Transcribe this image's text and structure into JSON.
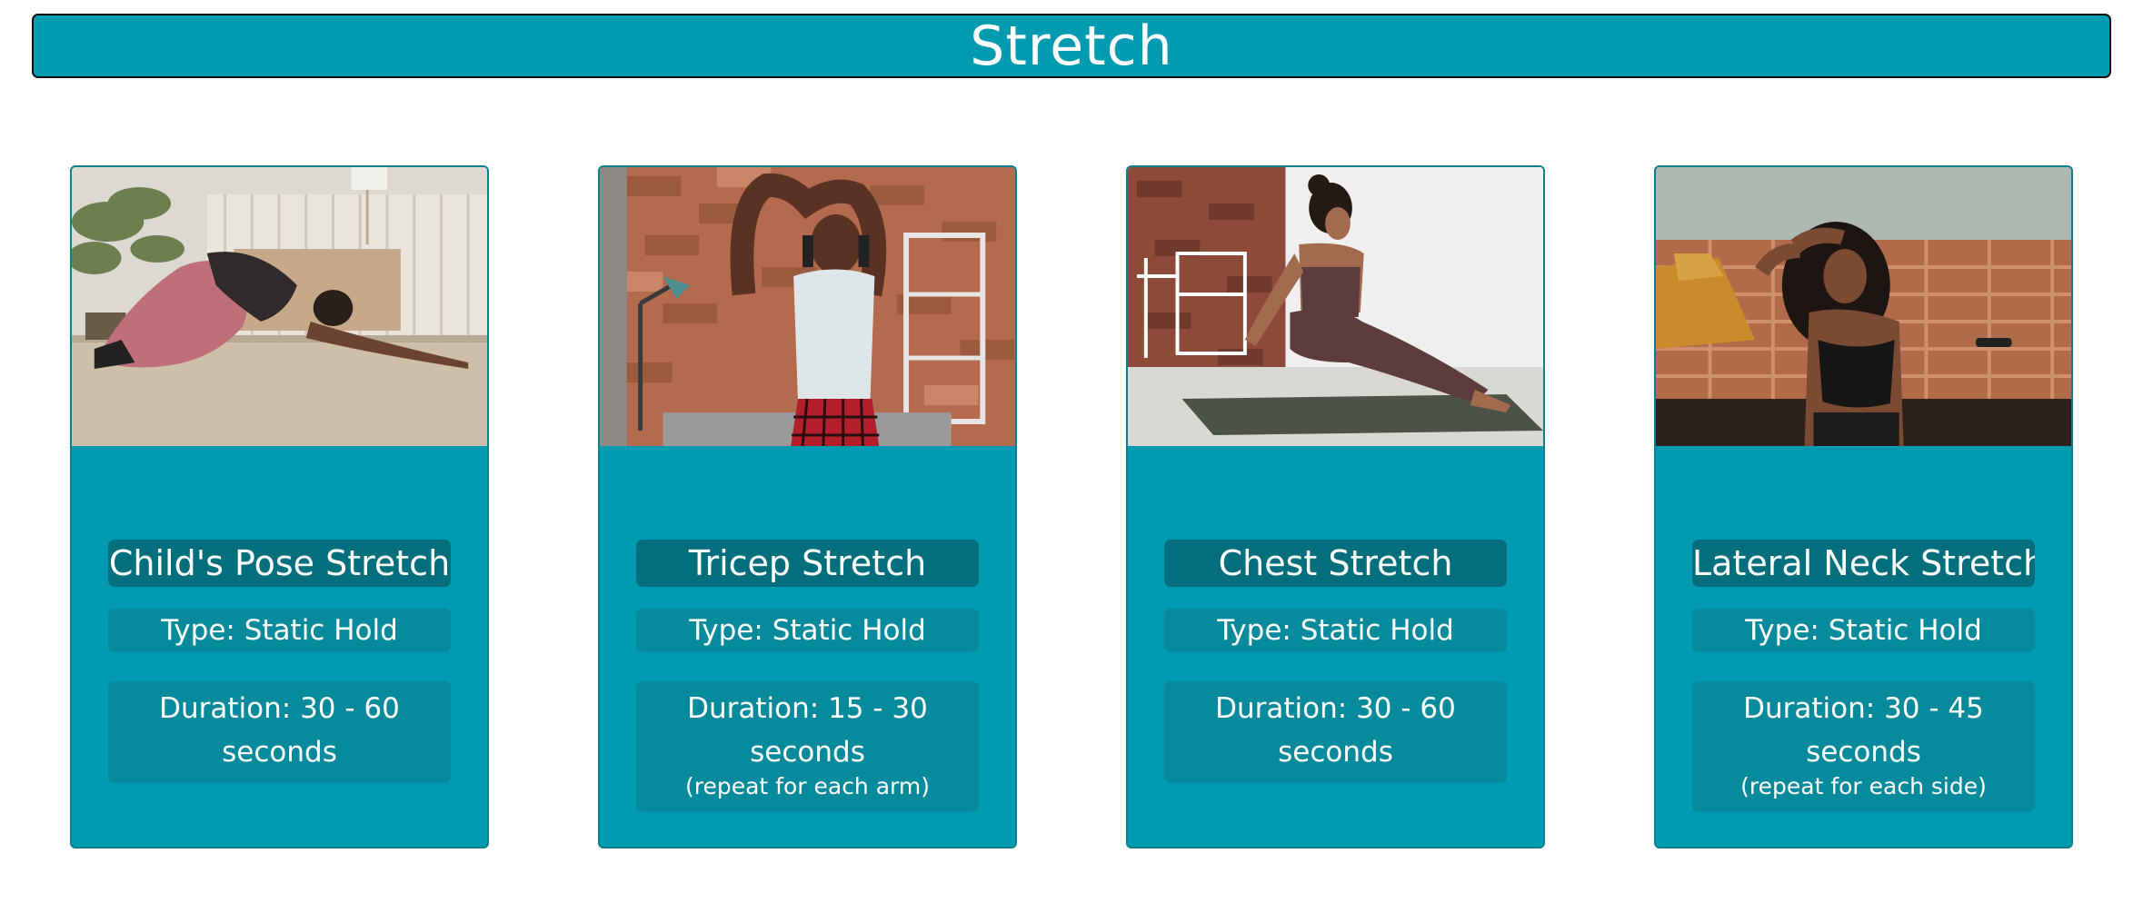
{
  "header": {
    "title": "Stretch"
  },
  "cards": [
    {
      "name": "Child's Pose Stretch",
      "type": "Type: Static Hold",
      "duration": "Duration: 30 - 60 seconds",
      "note": "",
      "photo_icon": "childs-pose-photo"
    },
    {
      "name": "Tricep Stretch",
      "type": "Type: Static Hold",
      "duration": "Duration: 15 - 30 seconds",
      "note": "(repeat for each arm)",
      "photo_icon": "tricep-stretch-photo"
    },
    {
      "name": "Chest Stretch",
      "type": "Type: Static Hold",
      "duration": "Duration: 30 - 60 seconds",
      "note": "",
      "photo_icon": "chest-stretch-photo"
    },
    {
      "name": "Lateral Neck Stretch",
      "type": "Type: Static Hold",
      "duration": "Duration: 30 - 45 seconds",
      "note": "(repeat for each side)",
      "photo_icon": "lateral-neck-stretch-photo"
    }
  ],
  "colors": {
    "header_bg": "#009bb0",
    "card_bg": "#009bb0",
    "title_pill": "#036f7c",
    "info_pill": "#078a9b"
  }
}
